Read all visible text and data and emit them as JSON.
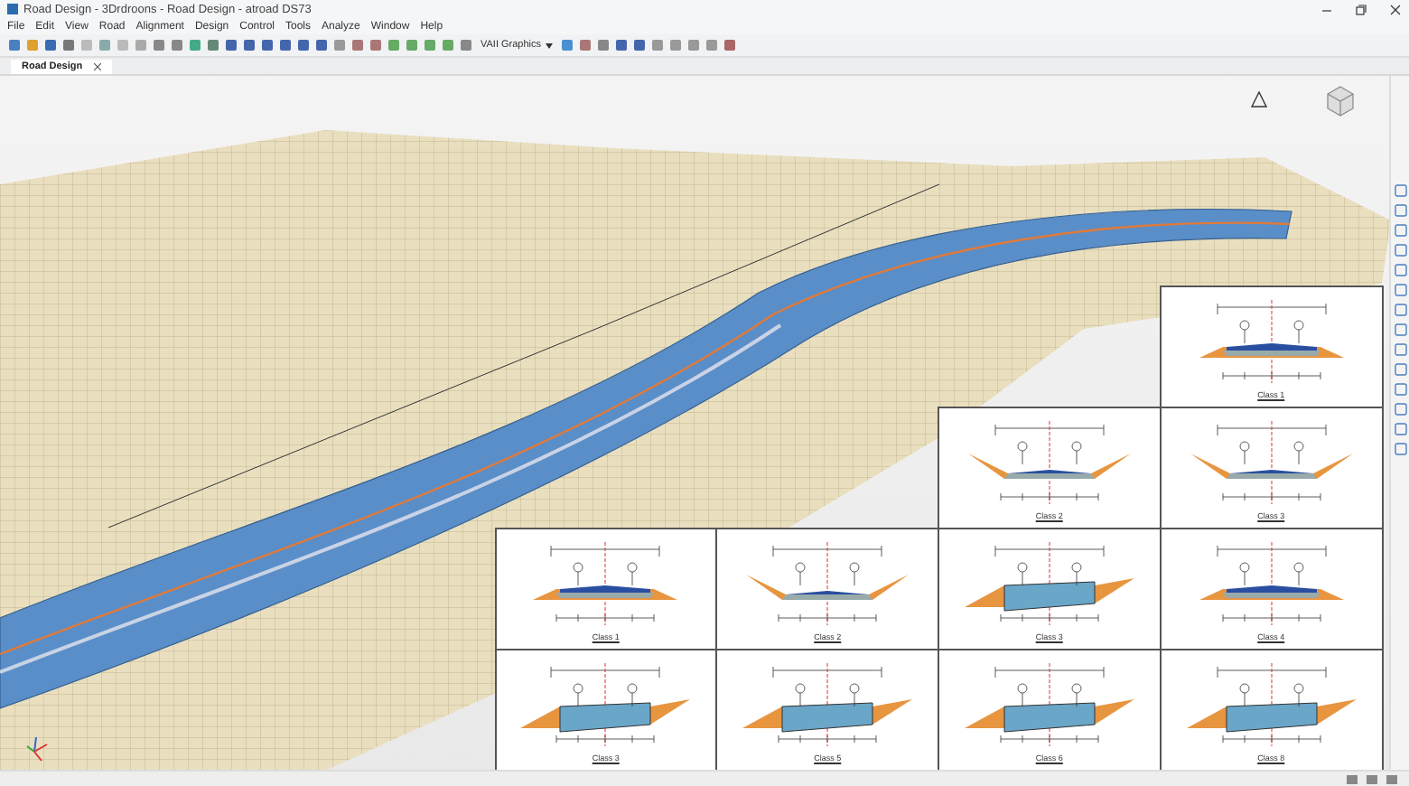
{
  "window": {
    "title": "Road Design - 3Drdroons - Road Design - atroad DS73"
  },
  "menu": [
    "File",
    "Edit",
    "View",
    "Road",
    "Alignment",
    "Design",
    "Control",
    "Tools",
    "Analyze",
    "Window",
    "Help"
  ],
  "toolbar": {
    "dropdown": "VAII Graphics"
  },
  "tabs": [
    {
      "label": "Road Design",
      "selected": true
    }
  ],
  "sections": [
    {
      "kind": "road",
      "caption": "Class 1"
    },
    {
      "kind": "cut",
      "caption": "Class 2"
    },
    {
      "kind": "cut",
      "caption": "Class 3"
    },
    {
      "kind": "road",
      "caption": "Class 1"
    },
    {
      "kind": "cut",
      "caption": "Class 2"
    },
    {
      "kind": "block",
      "caption": "Class 3"
    },
    {
      "kind": "road",
      "caption": "Class 4"
    },
    {
      "kind": "block",
      "caption": "Class 3"
    },
    {
      "kind": "block",
      "caption": "Class 5"
    },
    {
      "kind": "block",
      "caption": "Class 6"
    },
    {
      "kind": "block",
      "caption": "Class 8"
    }
  ]
}
